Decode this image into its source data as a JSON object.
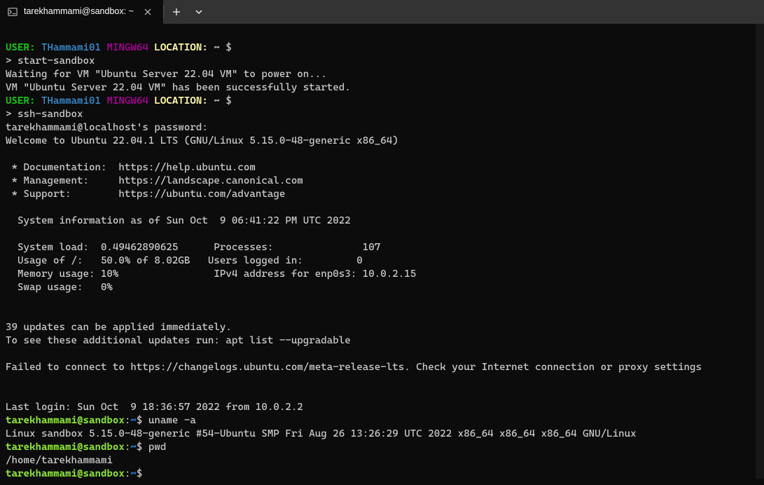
{
  "titlebar": {
    "tab_title": "tarekhammami@sandbox: ~",
    "tab_icon": "terminal-icon"
  },
  "term": {
    "p1_user_lbl": "USER:",
    "p1_user_val": " THammami01",
    "p1_mingw": " MINGW64",
    "p1_loc_lbl": " LOCATION:",
    "p1_loc_val": " ~ ",
    "p1_sigil": "$",
    "cmd1": "> start-sandbox",
    "out1a": "Waiting for VM \"Ubuntu Server 22.04 VM\" to power on...",
    "out1b": "VM \"Ubuntu Server 22.04 VM\" has been successfully started.",
    "cmd2": "> ssh-sandbox",
    "sshpw": "tarekhammami@localhost's password:",
    "welcome": "Welcome to Ubuntu 22.04.1 LTS (GNU/Linux 5.15.0-48-generic x86_64)",
    "doc": " * Documentation:  https://help.ubuntu.com",
    "mgmt": " * Management:     https://landscape.canonical.com",
    "sup": " * Support:        https://ubuntu.com/advantage",
    "sysinfo_hdr": "  System information as of Sun Oct  9 06:41:22 PM UTC 2022",
    "si1": "  System load:  0.49462890625      Processes:               107",
    "si2": "  Usage of /:   50.0% of 8.02GB   Users logged in:         0",
    "si3": "  Memory usage: 10%                IPv4 address for enp0s3: 10.0.2.15",
    "si4": "  Swap usage:   0%",
    "upd1": "39 updates can be applied immediately.",
    "upd2": "To see these additional updates run: apt list --upgradable",
    "fail": "Failed to connect to https://changelogs.ubuntu.com/meta-release-lts. Check your Internet connection or proxy settings",
    "lastlogin": "Last login: Sun Oct  9 18:36:57 2022 from 10.0.2.2",
    "ub_userhost": "tarekhammami@sandbox",
    "ub_colon": ":",
    "ub_path": "~",
    "ub_sigil": "$",
    "ucmd1": " uname -a",
    "uout1": "Linux sandbox 5.15.0-48-generic #54-Ubuntu SMP Fri Aug 26 13:26:29 UTC 2022 x86_64 x86_64 x86_64 GNU/Linux",
    "ucmd2": " pwd",
    "uout2": "/home/tarekhammami"
  },
  "colors": {
    "green": "#16c60c",
    "cyan": "#3a96dd",
    "magenta": "#b4009e",
    "yellow": "#f9f1a5",
    "white": "#cccccc",
    "lime": "#8be234",
    "blue": "#2472c8"
  }
}
